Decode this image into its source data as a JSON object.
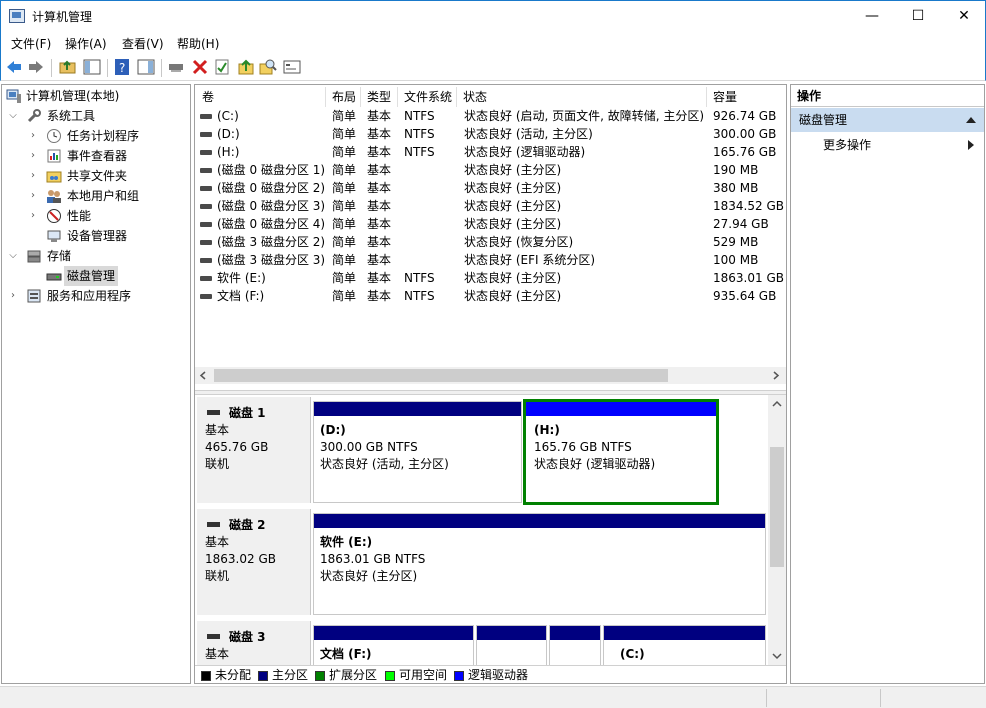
{
  "window": {
    "title": "计算机管理",
    "minimize": "—",
    "maximize": "☐",
    "close": "✕"
  },
  "menu": [
    "文件(F)",
    "操作(A)",
    "查看(V)",
    "帮助(H)"
  ],
  "tree": {
    "root": "计算机管理(本地)",
    "system_tools": "系统工具",
    "task_scheduler": "任务计划程序",
    "event_viewer": "事件查看器",
    "shared_folders": "共享文件夹",
    "local_users": "本地用户和组",
    "performance": "性能",
    "device_manager": "设备管理器",
    "storage": "存储",
    "disk_management": "磁盘管理",
    "services": "服务和应用程序"
  },
  "table": {
    "headers": [
      "卷",
      "布局",
      "类型",
      "文件系统",
      "状态",
      "容量"
    ],
    "rows": [
      [
        "(C:)",
        "简单",
        "基本",
        "NTFS",
        "状态良好 (启动, 页面文件, 故障转储, 主分区)",
        "926.74 GB"
      ],
      [
        "(D:)",
        "简单",
        "基本",
        "NTFS",
        "状态良好 (活动, 主分区)",
        "300.00 GB"
      ],
      [
        "(H:)",
        "简单",
        "基本",
        "NTFS",
        "状态良好 (逻辑驱动器)",
        "165.76 GB"
      ],
      [
        "(磁盘 0 磁盘分区 1)",
        "简单",
        "基本",
        "",
        "状态良好 (主分区)",
        "190 MB"
      ],
      [
        "(磁盘 0 磁盘分区 2)",
        "简单",
        "基本",
        "",
        "状态良好 (主分区)",
        "380 MB"
      ],
      [
        "(磁盘 0 磁盘分区 3)",
        "简单",
        "基本",
        "",
        "状态良好 (主分区)",
        "1834.52 GB"
      ],
      [
        "(磁盘 0 磁盘分区 4)",
        "简单",
        "基本",
        "",
        "状态良好 (主分区)",
        "27.94 GB"
      ],
      [
        "(磁盘 3 磁盘分区 2)",
        "简单",
        "基本",
        "",
        "状态良好 (恢复分区)",
        "529 MB"
      ],
      [
        "(磁盘 3 磁盘分区 3)",
        "简单",
        "基本",
        "",
        "状态良好 (EFI 系统分区)",
        "100 MB"
      ],
      [
        "软件 (E:)",
        "简单",
        "基本",
        "NTFS",
        "状态良好 (主分区)",
        "1863.01 GB"
      ],
      [
        "文档 (F:)",
        "简单",
        "基本",
        "NTFS",
        "状态良好 (主分区)",
        "935.64 GB"
      ]
    ]
  },
  "disks": {
    "disk1": {
      "name": "磁盘 1",
      "type": "基本",
      "size": "465.76 GB",
      "state": "联机",
      "p1": {
        "name": "(D:)",
        "size": "300.00 GB NTFS",
        "status": "状态良好 (活动, 主分区)"
      },
      "p2": {
        "name": "(H:)",
        "size": "165.76 GB NTFS",
        "status": "状态良好 (逻辑驱动器)"
      }
    },
    "disk2": {
      "name": "磁盘 2",
      "type": "基本",
      "size": "1863.02 GB",
      "state": "联机",
      "p1": {
        "name": "软件  (E:)",
        "size": "1863.01 GB NTFS",
        "status": "状态良好 (主分区)"
      }
    },
    "disk3": {
      "name": "磁盘 3",
      "type": "基本",
      "p1": {
        "name": "文档  (F:)"
      },
      "p4": {
        "name": "(C:)"
      }
    }
  },
  "legend": [
    "未分配",
    "主分区",
    "扩展分区",
    "可用空间",
    "逻辑驱动器"
  ],
  "colors": {
    "unallocated": "#000000",
    "primary": "#000080",
    "extended": "#008000",
    "free": "#00ff00",
    "logical": "#0000ff",
    "accent": "#1979ca"
  },
  "actions": {
    "header": "操作",
    "section": "磁盘管理",
    "more": "更多操作"
  }
}
